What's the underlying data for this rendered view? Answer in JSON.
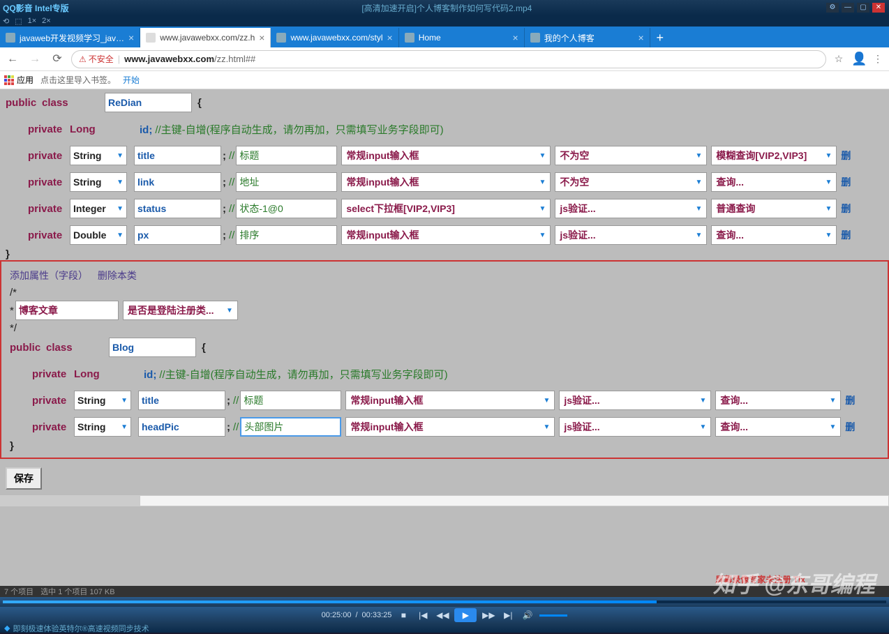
{
  "window": {
    "app_name": "QQ影音 Intel专版",
    "video_title": "[高清加速开启]个人博客制作如何写代码2.mp4"
  },
  "player_toolbar": [
    "⟲",
    "⬚",
    "1×",
    "2×"
  ],
  "tabs": [
    {
      "title": "javaweb开发视频学习_jav…",
      "active": false
    },
    {
      "title": "www.javawebxx.com/zz.h",
      "active": true
    },
    {
      "title": "www.javawebxx.com/styl",
      "active": false
    },
    {
      "title": "Home",
      "active": false
    },
    {
      "title": "我的个人博客",
      "active": false
    }
  ],
  "addressbar": {
    "insecure_label": "不安全",
    "url_host": "www.javawebxx.com",
    "url_path": "/zz.html##"
  },
  "bookmarks": {
    "apps": "应用",
    "hint": "点击这里导入书签。",
    "start": "开始"
  },
  "class1": {
    "public": "public",
    "class": "class",
    "name": "ReDian",
    "open": "{",
    "id_row": {
      "private": "private",
      "type": "Long",
      "field": "id;",
      "cmt": "//主键-自增(程序自动生成，请勿再加，只需填写业务字段即可)"
    },
    "fields": [
      {
        "private": "private",
        "type": "String",
        "name": "title",
        "cmt": "标题",
        "ctrl": "常规input输入框",
        "valid": "不为空",
        "query": "模糊查询[VIP2,VIP3]",
        "del": "删"
      },
      {
        "private": "private",
        "type": "String",
        "name": "link",
        "cmt": "地址",
        "ctrl": "常规input输入框",
        "valid": "不为空",
        "query": "查询...",
        "del": "删"
      },
      {
        "private": "private",
        "type": "Integer",
        "name": "status",
        "cmt": "状态-1@0",
        "ctrl": "select下拉框[VIP2,VIP3]",
        "valid": "js验证...",
        "query": "普通查询",
        "del": "删"
      },
      {
        "private": "private",
        "type": "Double",
        "name": "px",
        "cmt": "排序",
        "ctrl": "常规input输入框",
        "valid": "js验证...",
        "query": "查询...",
        "del": "删"
      }
    ],
    "close": "}"
  },
  "block_links": {
    "add": "添加属性（字段）",
    "del": "删除本类"
  },
  "comment": {
    "open": "/*",
    "star": "*",
    "close": "*/"
  },
  "class2_meta": {
    "desc": "博客文章",
    "login": "是否是登陆注册类..."
  },
  "class2": {
    "public": "public",
    "class": "class",
    "name": "Blog",
    "open": "{",
    "id_row": {
      "private": "private",
      "type": "Long",
      "field": "id;",
      "cmt": "//主键-自增(程序自动生成，请勿再加，只需填写业务字段即可)"
    },
    "fields": [
      {
        "private": "private",
        "type": "String",
        "name": "title",
        "cmt": "标题",
        "ctrl": "常规input输入框",
        "valid": "js验证...",
        "query": "查询...",
        "del": "删"
      },
      {
        "private": "private",
        "type": "String",
        "name": "headPic",
        "cmt": "头部图片",
        "ctrl": "常规input输入框",
        "valid": "js验证...",
        "query": "查询...",
        "del": "删"
      }
    ],
    "close": "}"
  },
  "save_btn": "保存",
  "recorder_text": "屏幕录像专家未注册 Tlx",
  "watermark": "知乎 @东哥编程",
  "statusbar": {
    "items": "7 个项目",
    "sel": "选中 1 个项目  107 KB"
  },
  "player": {
    "cur": "00:25:00",
    "total": "00:33:25"
  },
  "infobar": "即刻极速体验英特尔®高速视频同步技术"
}
